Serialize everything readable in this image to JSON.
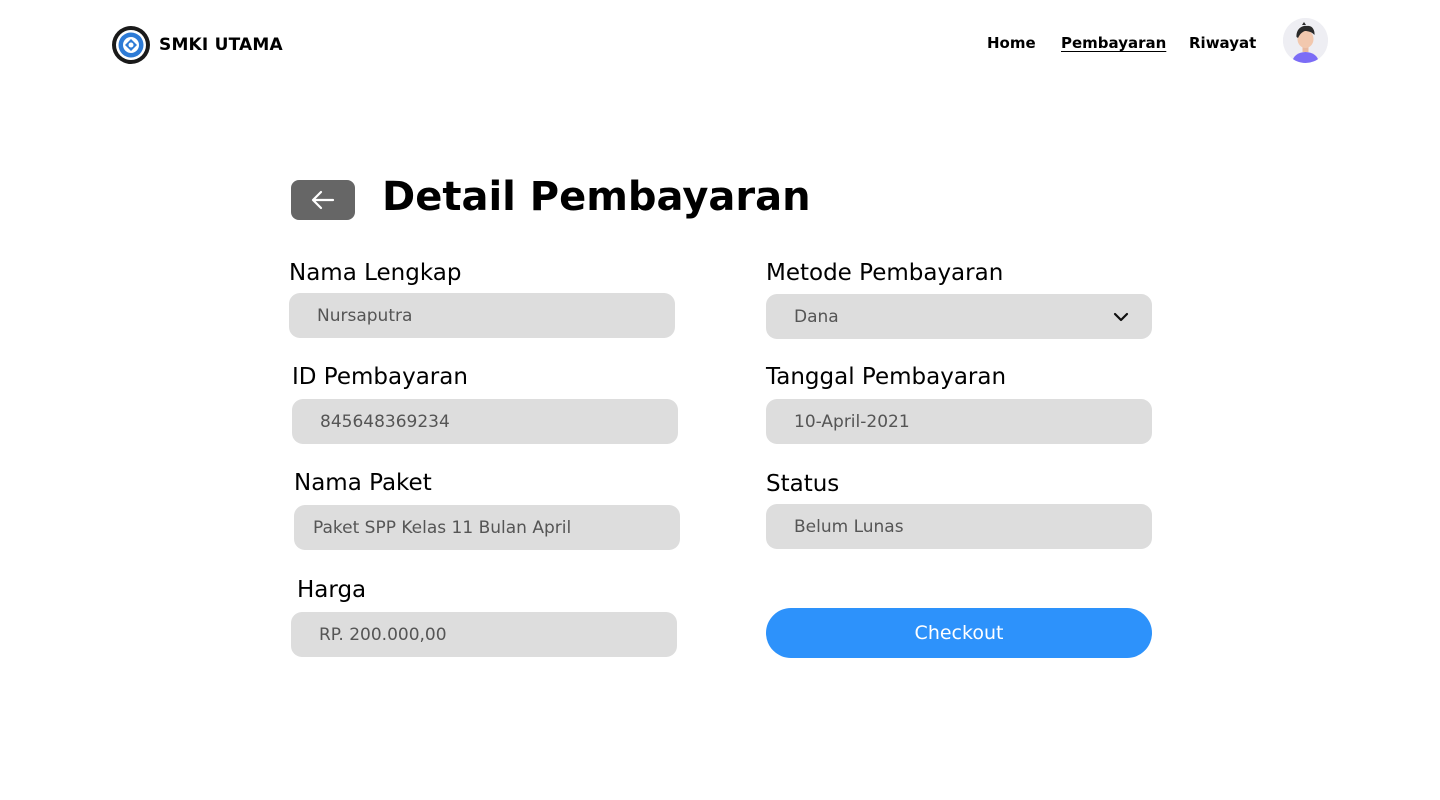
{
  "header": {
    "brand_name": "SMKI UTAMA",
    "nav": {
      "home": "Home",
      "pembayaran": "Pembayaran",
      "riwayat": "Riwayat"
    }
  },
  "main": {
    "title": "Detail Pembayaran",
    "fields": {
      "nama_lengkap": {
        "label": "Nama Lengkap",
        "value": "Nursaputra"
      },
      "id_pembayaran": {
        "label": "ID Pembayaran",
        "value": "845648369234"
      },
      "nama_paket": {
        "label": "Nama Paket",
        "value": "Paket SPP Kelas 11 Bulan April"
      },
      "harga": {
        "label": "Harga",
        "value": "RP. 200.000,00"
      },
      "metode_pembayaran": {
        "label": "Metode Pembayaran",
        "value": "Dana"
      },
      "tanggal_pembayaran": {
        "label": "Tanggal Pembayaran",
        "value": "10-April-2021"
      },
      "status": {
        "label": "Status",
        "value": "Belum Lunas"
      }
    },
    "checkout_label": "Checkout"
  },
  "colors": {
    "accent": "#2d92fb",
    "field_bg": "#dddddd",
    "back_button": "#666666",
    "avatar_shirt": "#7b6cf6"
  },
  "icons": {
    "logo": "school-emblem-icon",
    "back": "arrow-left-icon",
    "dropdown": "chevron-down-icon",
    "avatar": "user-avatar-icon"
  }
}
